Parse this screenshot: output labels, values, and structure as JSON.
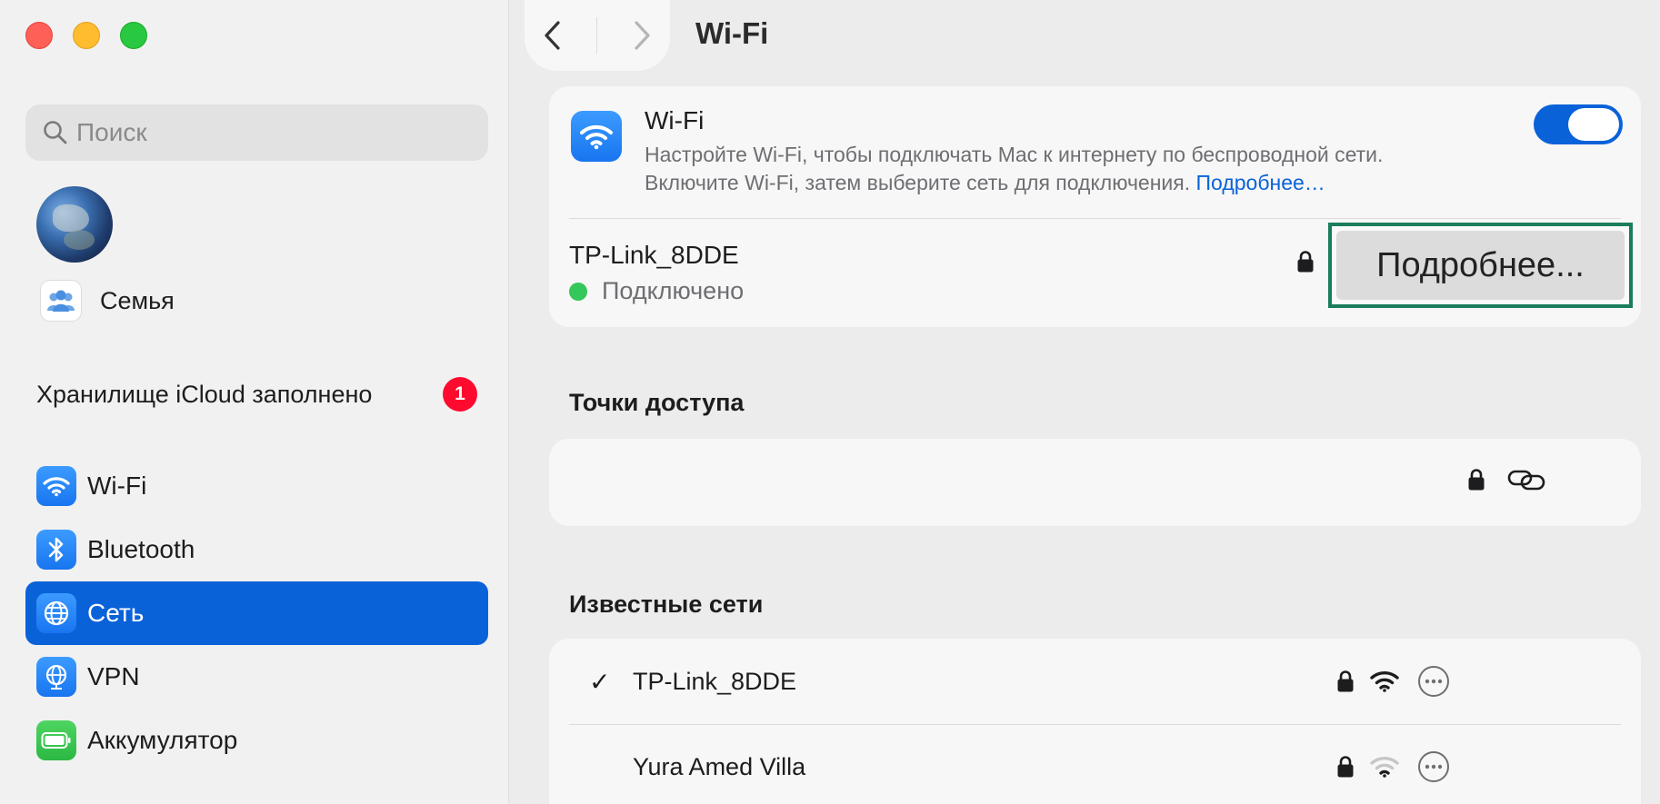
{
  "sidebar": {
    "search_placeholder": "Поиск",
    "family_label": "Семья",
    "icloud_label": "Хранилище iCloud заполнено",
    "icloud_badge": "1",
    "items": [
      {
        "label": "Wi-Fi",
        "icon": "wifi-icon"
      },
      {
        "label": "Bluetooth",
        "icon": "bluetooth-icon"
      },
      {
        "label": "Сеть",
        "icon": "globe-icon",
        "active": true
      },
      {
        "label": "VPN",
        "icon": "vpn-globe-icon"
      },
      {
        "label": "Аккумулятор",
        "icon": "battery-icon"
      }
    ]
  },
  "main": {
    "title": "Wi-Fi",
    "wifi": {
      "title": "Wi-Fi",
      "desc_line1": "Настройте Wi-Fi, чтобы подключать Mac к интернету по беспроводной сети.",
      "desc_line2": "Включите Wi-Fi, затем выберите сеть для подключения.",
      "desc_link": "Подробнее…",
      "toggle_on": true
    },
    "current": {
      "name": "TP-Link_8DDE",
      "status": "Подключено",
      "details_button": "Подробнее..."
    },
    "hotspots_title": "Точки доступа",
    "known_title": "Известные сети",
    "known": [
      {
        "name": "TP-Link_8DDE",
        "checked": true,
        "check": "✓"
      },
      {
        "name": "Yura Amed Villa",
        "checked": false,
        "check": ""
      }
    ]
  },
  "colors": {
    "accent": "#0a62d9",
    "connected": "#34c759",
    "badge": "#ff0a2f",
    "highlight_border": "#1a7d5c"
  }
}
